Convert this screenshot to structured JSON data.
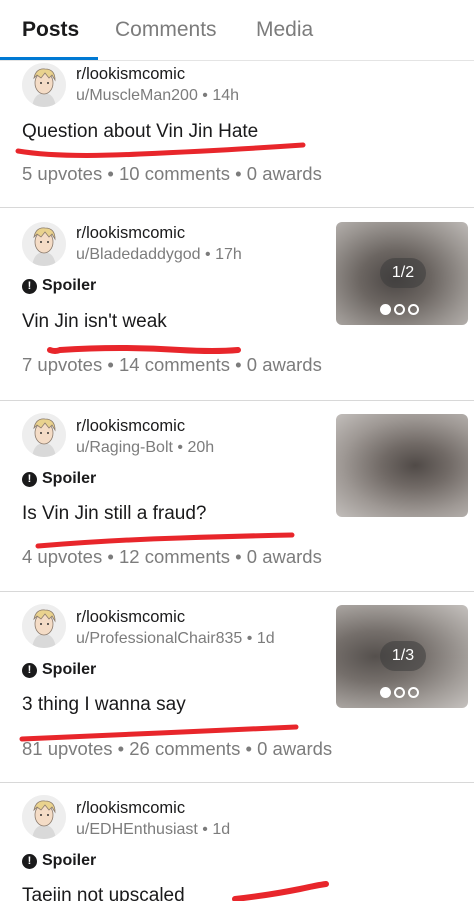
{
  "tabs": [
    {
      "label": "Posts",
      "active": true
    },
    {
      "label": "Comments",
      "active": false
    },
    {
      "label": "Media",
      "active": false
    }
  ],
  "posts": [
    {
      "subreddit": "r/lookismcomic",
      "user": "u/MuscleMan200",
      "age": "14h",
      "spoiler": false,
      "title": "Question about Vin Jin Hate",
      "stats": "5 upvotes • 10 comments • 0 awards",
      "thumbnail": false
    },
    {
      "subreddit": "r/lookismcomic",
      "user": "u/Bladedaddygod",
      "age": "17h",
      "spoiler": true,
      "spoiler_label": "Spoiler",
      "title": "Vin Jin isn't weak",
      "stats": "7 upvotes • 14 comments • 0 awards",
      "thumbnail": true,
      "gallery_counter": "1/2"
    },
    {
      "subreddit": "r/lookismcomic",
      "user": "u/Raging-Bolt",
      "age": "20h",
      "spoiler": true,
      "spoiler_label": "Spoiler",
      "title": "Is Vin Jin still a fraud?",
      "stats": "4 upvotes • 12 comments • 0 awards",
      "thumbnail": true
    },
    {
      "subreddit": "r/lookismcomic",
      "user": "u/ProfessionalChair835",
      "age": "1d",
      "spoiler": true,
      "spoiler_label": "Spoiler",
      "title": "3 thing I wanna say",
      "stats": "81 upvotes • 26 comments • 0 awards",
      "thumbnail": true,
      "gallery_counter": "1/3"
    },
    {
      "subreddit": "r/lookismcomic",
      "user": "u/EDHEnthusiast",
      "age": "1d",
      "spoiler": true,
      "spoiler_label": "Spoiler",
      "title": "Taejin not upscaled",
      "thumbnail": false
    }
  ],
  "colors": {
    "accent": "#0079d3",
    "scribble": "#e8262b",
    "meta_text": "#7c7c7c"
  },
  "icons": {
    "spoiler": "exclamation-circle-icon",
    "avatar": "snoo-avatar-icon"
  }
}
